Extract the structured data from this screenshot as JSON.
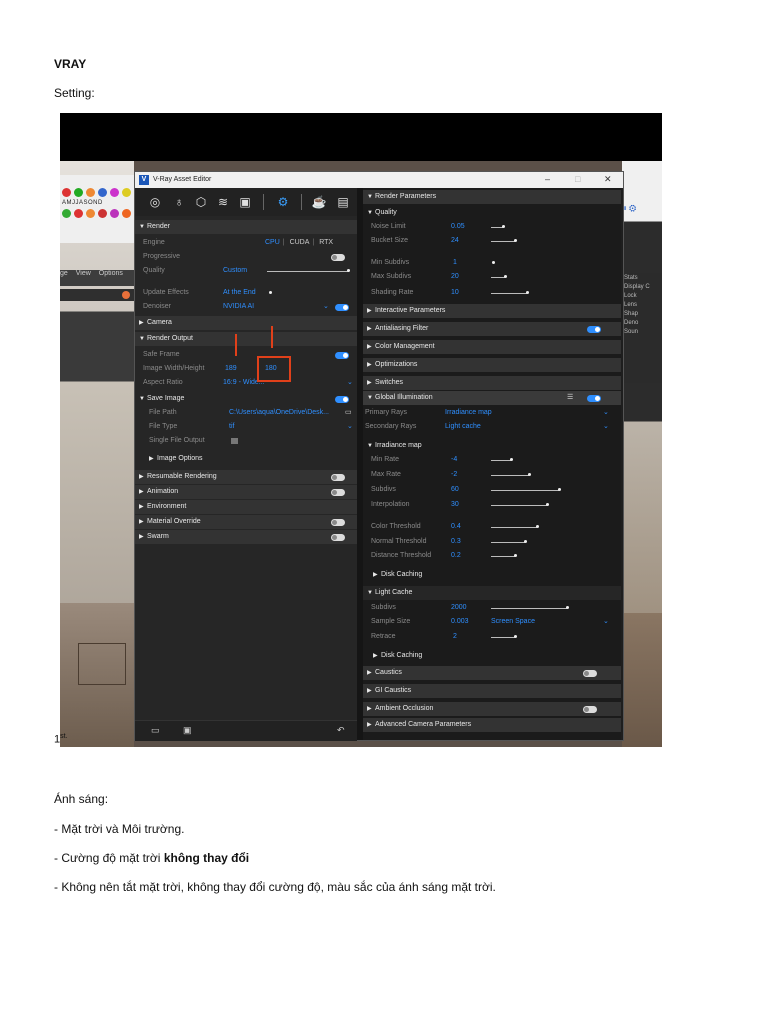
{
  "document": {
    "title": "VRAY",
    "subtitle": "Setting:",
    "figure_number": "1",
    "figure_suffix": "st.",
    "paragraphs": [
      {
        "text": "Ánh sáng:",
        "bold": ""
      },
      {
        "text": "- Mặt trời và Môi trường.",
        "bold": ""
      },
      {
        "text": "- Cường độ mặt trời ",
        "bold": "không thay đổi"
      },
      {
        "text": "- Không nên tắt mặt trời, không thay đổi cường độ, màu sắc của ánh sáng mặt trời.",
        "bold": ""
      }
    ]
  },
  "background_app": {
    "months": "AMJJASOND",
    "menu": [
      "ge",
      "View",
      "Options"
    ],
    "right_panel": [
      "Stats",
      "Display C",
      "Lock",
      "Lens",
      "Shap",
      "Deno",
      "Soun"
    ]
  },
  "window": {
    "logo": "V",
    "title": "V-Ray Asset Editor",
    "controls": [
      "–",
      "□",
      "✕"
    ],
    "toolbar_icons": [
      "sphere-icon",
      "bulb-icon",
      "cube-icon",
      "layers-icon",
      "texture-icon",
      "settings-icon",
      "teapot-icon",
      "render-window-icon"
    ],
    "left": {
      "render_header": "Render",
      "engine_label": "Engine",
      "engine_options": [
        "CPU",
        "CUDA",
        "RTX"
      ],
      "progressive_label": "Progressive",
      "quality_label": "Quality",
      "quality_value": "Custom",
      "update_effects_label": "Update Effects",
      "update_effects_value": "At the End",
      "denoiser_label": "Denoiser",
      "denoiser_value": "NVIDIA AI",
      "camera_header": "Camera",
      "render_output_header": "Render Output",
      "safe_frame_label": "Safe Frame",
      "image_wh_label": "Image Width/Height",
      "image_width": "189",
      "image_height": "180",
      "aspect_ratio_label": "Aspect Ratio",
      "aspect_ratio_value": "16:9 - Wide...",
      "save_image_header": "Save Image",
      "file_path_label": "File Path",
      "file_path_value": "C:\\Users\\aqua\\OneDrive\\Desk...",
      "file_type_label": "File Type",
      "file_type_value": "tif",
      "single_file_label": "Single File Output",
      "image_options_header": "Image Options",
      "resumable_header": "Resumable Rendering",
      "animation_header": "Animation",
      "environment_header": "Environment",
      "material_override_header": "Material Override",
      "swarm_header": "Swarm"
    },
    "right": {
      "render_params_header": "Render Parameters",
      "quality_header": "Quality",
      "noise_limit_label": "Noise Limit",
      "noise_limit_value": "0.05",
      "bucket_size_label": "Bucket Size",
      "bucket_size_value": "24",
      "min_subdivs_label": "Min Subdivs",
      "min_subdivs_value": "1",
      "max_subdivs_label": "Max Subdivs",
      "max_subdivs_value": "20",
      "shading_rate_label": "Shading Rate",
      "shading_rate_value": "10",
      "interactive_header": "Interactive Parameters",
      "antialiasing_header": "Antialiasing Filter",
      "color_mgmt_header": "Color Management",
      "optimizations_header": "Optimizations",
      "switches_header": "Switches",
      "gi_header": "Global Illumination",
      "primary_rays_label": "Primary Rays",
      "primary_rays_value": "Irradiance map",
      "secondary_rays_label": "Secondary Rays",
      "secondary_rays_value": "Light cache",
      "irradiance_header": "Irradiance map",
      "min_rate_label": "Min Rate",
      "min_rate_value": "-4",
      "max_rate_label": "Max Rate",
      "max_rate_value": "-2",
      "subdivs_label": "Subdivs",
      "subdivs_value": "60",
      "interpolation_label": "Interpolation",
      "interpolation_value": "30",
      "color_threshold_label": "Color Threshold",
      "color_threshold_value": "0.4",
      "normal_threshold_label": "Normal Threshold",
      "normal_threshold_value": "0.3",
      "distance_threshold_label": "Distance Threshold",
      "distance_threshold_value": "0.2",
      "disk_caching_label": "Disk Caching",
      "light_cache_header": "Light Cache",
      "lc_subdivs_label": "Subdivs",
      "lc_subdivs_value": "2000",
      "sample_size_label": "Sample Size",
      "sample_size_value": "0.003",
      "sample_space_value": "Screen Space",
      "retrace_label": "Retrace",
      "retrace_value": "2",
      "disk_caching2_label": "Disk Caching",
      "caustics_header": "Caustics",
      "gi_caustics_header": "GI Caustics",
      "ao_header": "Ambient Occlusion",
      "adv_camera_header": "Advanced Camera Parameters"
    },
    "bottom_icons": [
      "folder-open-icon",
      "save-icon",
      "undo-icon"
    ]
  },
  "colors": {
    "accent": "#2f8fff",
    "highlight": "#e0401a",
    "panel": "#262626"
  }
}
